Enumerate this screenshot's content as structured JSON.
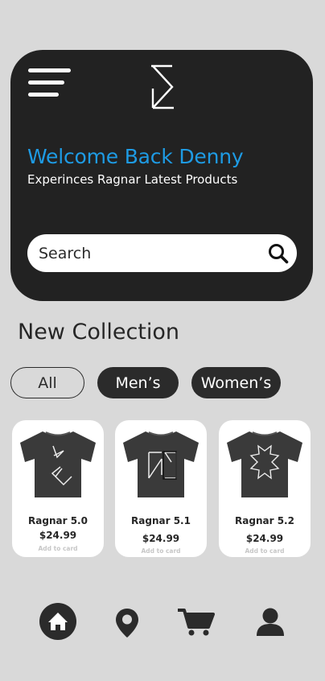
{
  "header": {
    "welcome": "Welcome Back Denny",
    "subtitle": "Experinces Ragnar Latest Products",
    "search_placeholder": "Search"
  },
  "collection": {
    "title": "New Collection",
    "filters": [
      {
        "label": "All",
        "active": false
      },
      {
        "label": "Men’s",
        "active": true
      },
      {
        "label": "Women’s",
        "active": true
      }
    ]
  },
  "products": [
    {
      "name": "Ragnar 5.0",
      "price": "$24.99",
      "cta": "Add to card"
    },
    {
      "name": "Ragnar 5.1",
      "price": "$24.99",
      "cta": "Add to card"
    },
    {
      "name": "Ragnar 5.2",
      "price": "$24.99",
      "cta": "Add to card"
    }
  ],
  "nav": {
    "items": [
      {
        "icon": "home-icon",
        "active": true
      },
      {
        "icon": "location-pin-icon",
        "active": false
      },
      {
        "icon": "cart-icon",
        "active": false
      },
      {
        "icon": "user-icon",
        "active": false
      }
    ]
  },
  "colors": {
    "background": "#d9d9d9",
    "hero": "#222222",
    "accent": "#1e9be4",
    "dark": "#2b2b2b",
    "card": "#ffffff"
  }
}
